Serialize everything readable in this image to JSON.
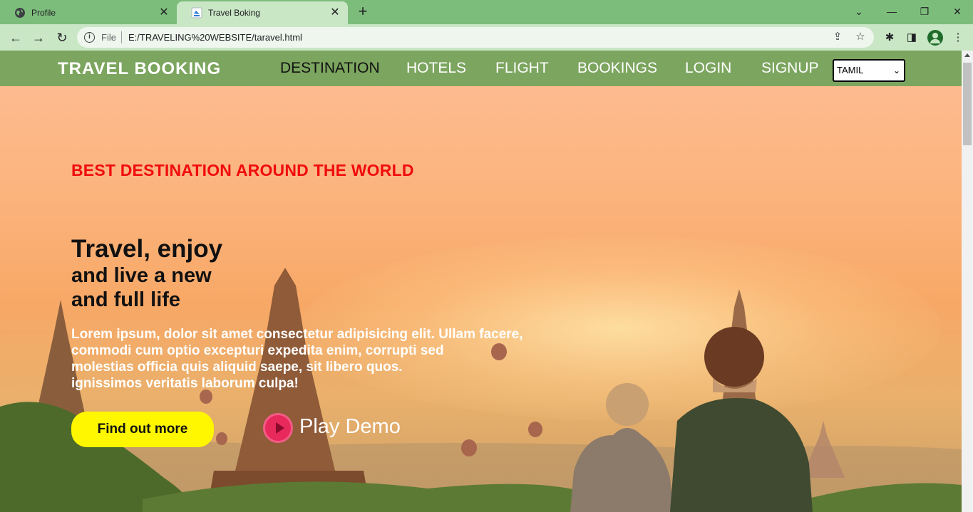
{
  "browser": {
    "tabs": [
      {
        "title": "Profile",
        "active": false
      },
      {
        "title": "Travel Boking",
        "active": true
      }
    ],
    "address": {
      "scheme_label": "File",
      "url": "E:/TRAVELING%20WEBSITE/taravel.html"
    }
  },
  "site": {
    "brand": "TRAVEL BOOKING",
    "nav": [
      "DESTINATION",
      "HOTELS",
      "FLIGHT",
      "BOOKINGS",
      "LOGIN",
      "SIGNUP"
    ],
    "language": {
      "selected": "TAMIL"
    }
  },
  "hero": {
    "tagline": "BEST DESTINATION AROUND THE WORLD",
    "headline": [
      "Travel, enjoy",
      "and live a new",
      "and full life"
    ],
    "body": [
      "Lorem ipsum, dolor sit amet consectetur adipisicing elit. Ullam facere,",
      "commodi cum optio excepturi expedita enim, corrupti sed",
      "molestias officia quis aliquid saepe, sit libero quos.",
      "ignissimos veritatis laborum culpa!"
    ],
    "cta_label": "Find out more",
    "play_label": "Play Demo"
  },
  "colors": {
    "navbar": "#7ca55f",
    "tagline": "#f00c0c",
    "cta": "#fff700",
    "play": "#e8295c"
  }
}
